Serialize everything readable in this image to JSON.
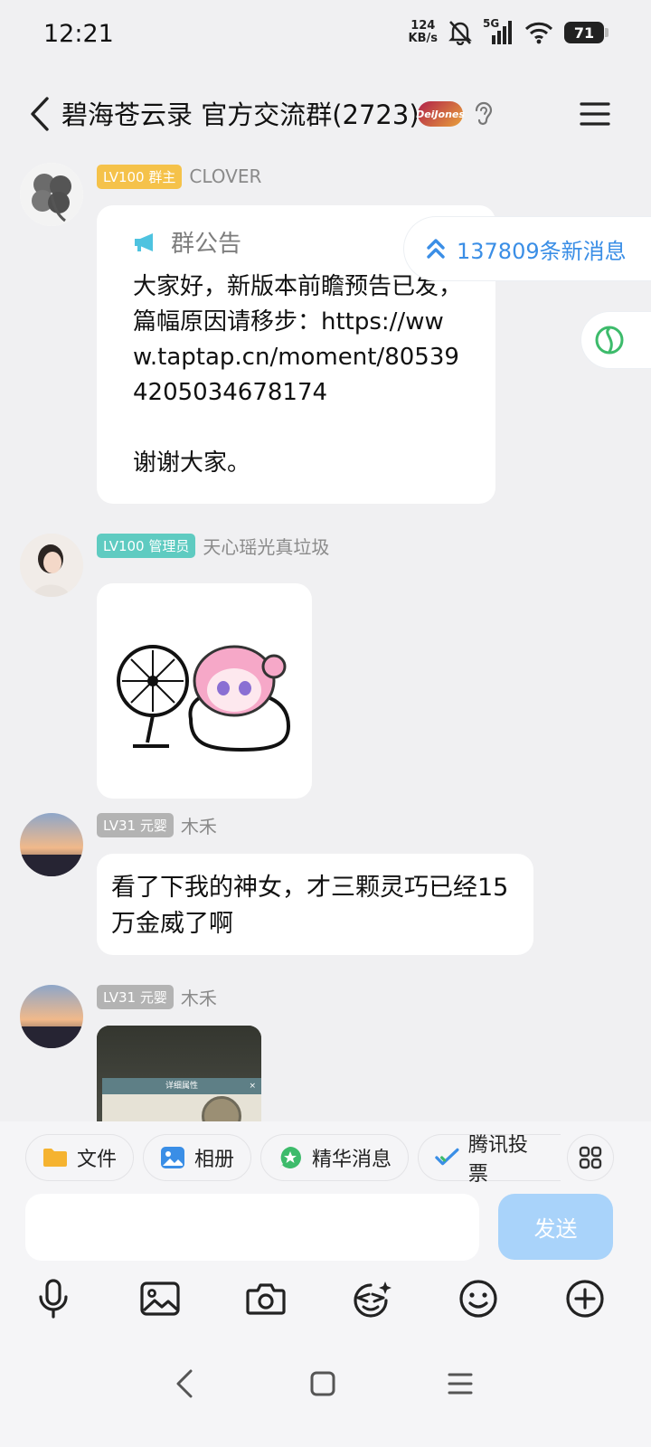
{
  "status_bar": {
    "time": "12:21",
    "net_speed_value": "124",
    "net_speed_unit": "KB/s",
    "network_type": "5G",
    "battery": "71"
  },
  "header": {
    "title": "碧海苍云录 官方交流群(2723)",
    "badge_text": "DeiJones"
  },
  "messages": [
    {
      "level": "LV100 群主",
      "sender": "CLOVER",
      "notice_title": "群公告",
      "notice_text": "大家好，新版本前瞻预告已发，篇幅原因请移步：https://www.taptap.cn/moment/805394205034678174\n\n谢谢大家。"
    },
    {
      "level": "LV100 管理员",
      "sender": "天心瑶光真垃圾"
    },
    {
      "level": "LV31 元婴",
      "sender": "木禾",
      "text": "看了下我的神女，才三颗灵巧已经15万金威了啊"
    },
    {
      "level": "LV31 元婴",
      "sender": "木禾",
      "image_title": "详细属性"
    }
  ],
  "new_messages": "137809条新消息",
  "quick_actions": [
    {
      "label": "文件",
      "icon": "folder-icon"
    },
    {
      "label": "相册",
      "icon": "album-icon"
    },
    {
      "label": "精华消息",
      "icon": "essence-icon"
    },
    {
      "label": "腾讯投票",
      "icon": "vote-icon"
    }
  ],
  "input": {
    "placeholder": "",
    "send_label": "发送"
  },
  "colors": {
    "accent": "#3a8ee6",
    "owner_badge": "#f5c24a",
    "admin_badge": "#5fcbc1",
    "member_badge": "#b3b3b3",
    "send_disabled": "#a9d3fa"
  }
}
